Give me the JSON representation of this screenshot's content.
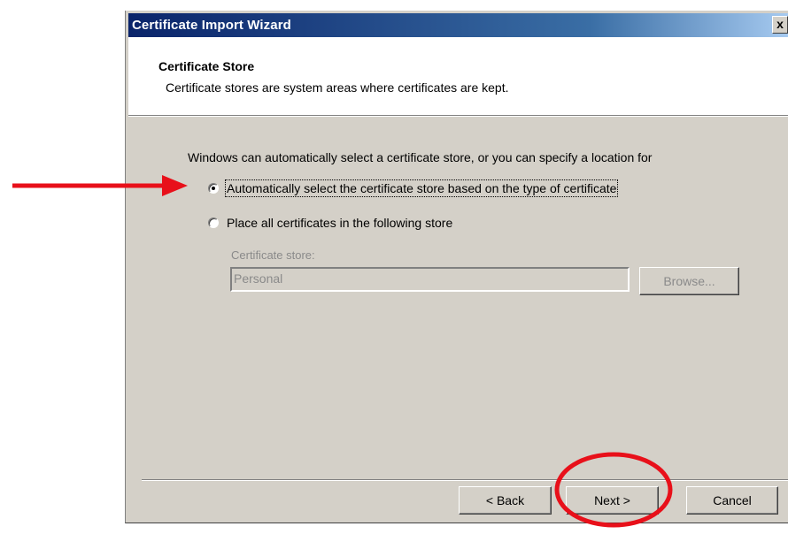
{
  "window": {
    "title": "Certificate Import Wizard",
    "close_glyph": "x"
  },
  "header": {
    "title": "Certificate Store",
    "subtitle": "Certificate stores are system areas where certificates are kept."
  },
  "body": {
    "intro": "Windows can automatically select a certificate store, or you can specify a location for",
    "options": [
      {
        "label": "Automatically select the certificate store based on the type of certificate",
        "checked": true
      },
      {
        "label": "Place all certificates in the following store",
        "checked": false
      }
    ],
    "store_label": "Certificate store:",
    "store_value": "Personal",
    "browse_label": "Browse..."
  },
  "footer": {
    "back_label": "< Back",
    "next_label": "Next >",
    "cancel_label": "Cancel"
  },
  "annotations": {
    "arrow_color": "#e8101a",
    "circle_color": "#e8101a"
  }
}
